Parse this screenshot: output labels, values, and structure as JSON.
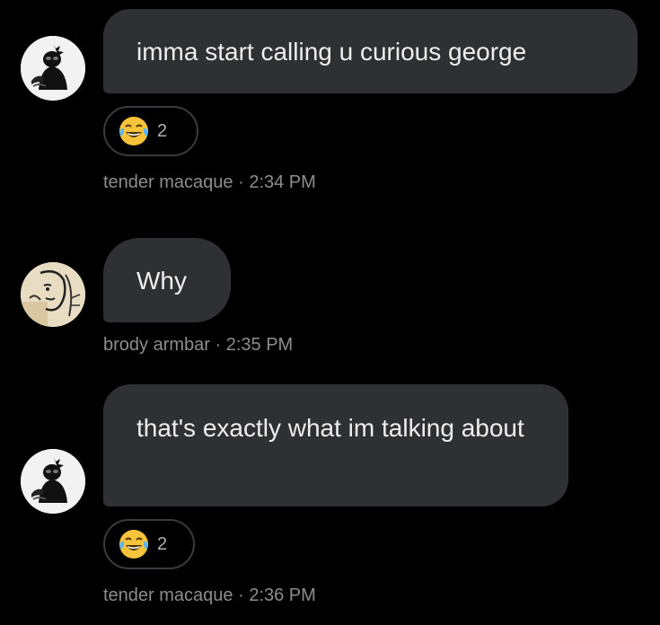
{
  "messages": [
    {
      "text": "imma start calling u curious george",
      "reaction": {
        "emoji": "joy-emoji",
        "count": "2"
      },
      "meta": "tender macaque · 2:34 PM",
      "avatar": "monkey-figure-avatar"
    },
    {
      "text": "Why",
      "meta": "brody armbar · 2:35 PM",
      "avatar": "sketch-portrait-avatar"
    },
    {
      "text": "that's exactly what im talking about",
      "reaction": {
        "emoji": "joy-emoji",
        "count": "2"
      },
      "meta": "tender macaque · 2:36 PM",
      "avatar": "monkey-figure-avatar"
    }
  ],
  "colors": {
    "background": "#000000",
    "bubble": "#2f3033",
    "bubble_text": "#eeeeee",
    "meta_text": "#8d8d8d",
    "reaction_border": "#3a3b3e"
  }
}
